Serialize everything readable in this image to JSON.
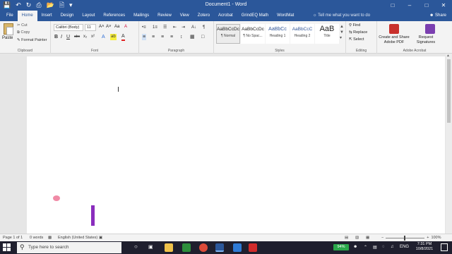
{
  "titlebar": {
    "title": "Document1 - Word",
    "qat_icons": [
      "save-icon",
      "undo-icon",
      "redo-icon",
      "print-icon",
      "open-icon",
      "new-document-icon",
      "customize-icon"
    ],
    "window_controls": [
      "ribbon-display-icon",
      "minimize-icon",
      "maximize-icon",
      "close-icon"
    ]
  },
  "tabs": [
    "File",
    "Home",
    "Insert",
    "Design",
    "Layout",
    "References",
    "Mailings",
    "Review",
    "View",
    "Zotero",
    "Acrobat",
    "GrindEQ Math",
    "WordMat"
  ],
  "active_tab": "Home",
  "tell_me": "Tell me what you want to do",
  "share": "Share",
  "ribbon": {
    "clipboard": {
      "label": "Clipboard",
      "paste": "Paste",
      "cut": "Cut",
      "copy": "Copy",
      "format_painter": "Format Painter"
    },
    "font": {
      "label": "Font",
      "font_name": "Calibri (Body)",
      "font_size": "11",
      "bold": "B",
      "italic": "I",
      "underline": "U",
      "grow": "A˄",
      "shrink": "A˅",
      "case": "Aa",
      "clear": "A",
      "strike": "abc",
      "subscript": "x₂",
      "superscript": "x²",
      "effects": "A",
      "highlight": "ab",
      "font_color": "A"
    },
    "paragraph": {
      "label": "Paragraph",
      "row1": [
        "•≡",
        "1≡",
        "☰",
        "⇤",
        "⇥",
        "A↓",
        "¶"
      ],
      "row2": [
        "≡",
        "≡",
        "≡",
        "≡",
        "↕",
        "▦",
        "□"
      ]
    },
    "styles": {
      "label": "Styles",
      "items": [
        {
          "sample": "AaBbCcDc",
          "name": "¶ Normal"
        },
        {
          "sample": "AaBbCcDc",
          "name": "¶ No Spac..."
        },
        {
          "sample": "AaBbCc",
          "name": "Heading 1"
        },
        {
          "sample": "AaBbCcC",
          "name": "Heading 2"
        },
        {
          "sample": "AaB",
          "name": "Title"
        }
      ]
    },
    "editing": {
      "label": "Editing",
      "find": "Find",
      "replace": "Replace",
      "select": "Select"
    },
    "acrobat": {
      "label": "Adobe Acrobat",
      "create_share": "Create and Share Adobe PDF",
      "request_sig": "Request Signatures"
    }
  },
  "statusbar": {
    "page": "Page 1 of 1",
    "words": "0 words",
    "language": "English (United States)",
    "zoom_minus": "−",
    "zoom_plus": "+",
    "zoom": "100%"
  },
  "taskbar": {
    "search_placeholder": "Type here to search",
    "battery": "94%",
    "time": "7:31 PM",
    "date": "10/8/2021",
    "language": "ENG"
  },
  "colors": {
    "word_blue": "#2b579a",
    "ink_pink": "#f08aa6",
    "ink_purple": "#8a2dbd"
  }
}
